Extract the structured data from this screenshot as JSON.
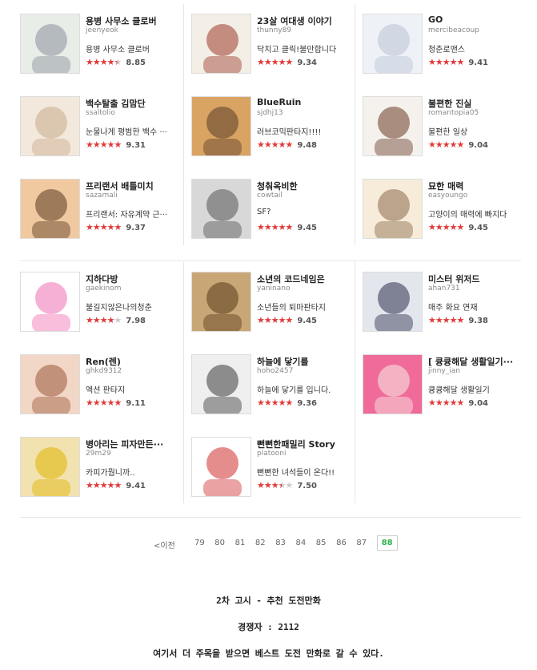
{
  "sections": [
    {
      "rows": [
        [
          {
            "title": "용병 사무소 클로버",
            "author": "jeenyeok",
            "desc": "용병 사무소 클로버",
            "score": "8.85",
            "stars": 4.5,
            "thumb": {
              "bg": "#e8ede8",
              "fg": "#8a8f9a"
            }
          },
          {
            "title": "23살 여대생 이야기",
            "author": "thunny89",
            "desc": "닥치고 클릭!불만합니다",
            "score": "9.34",
            "stars": 5,
            "thumb": {
              "bg": "#f4efe6",
              "fg": "#9a3b2a"
            }
          },
          {
            "title": "GO",
            "author": "mercibeacoup",
            "desc": "청춘로맨스",
            "score": "9.41",
            "stars": 5,
            "thumb": {
              "bg": "#eef1f6",
              "fg": "#b9c3d6"
            }
          }
        ],
        [
          {
            "title": "백수탈출 김맘단",
            "author": "ssaltolio",
            "desc": "눈물나게 평범한 백수 ···",
            "score": "9.31",
            "stars": 5,
            "thumb": {
              "bg": "#f2e9dc",
              "fg": "#c9a98a"
            }
          },
          {
            "title": "BlueRuin",
            "author": "sjdhj13",
            "desc": "러브코믹판타지!!!!",
            "score": "9.48",
            "stars": 5,
            "thumb": {
              "bg": "#d9a463",
              "fg": "#5a3c2a"
            }
          },
          {
            "title": "불편한 진실",
            "author": "romantopia05",
            "desc": "불편한 일상",
            "score": "9.04",
            "stars": 5,
            "thumb": {
              "bg": "#f5f2ee",
              "fg": "#6a3a25"
            }
          }
        ],
        [
          {
            "title": "프리랜서 배틀미치",
            "author": "sazamali",
            "desc": "프리랜서: 자유계약 근···",
            "score": "9.37",
            "stars": 5,
            "thumb": {
              "bg": "#f0c9a0",
              "fg": "#5a3a20"
            }
          },
          {
            "title": "청춰옥비한",
            "author": "cowtail",
            "desc": "SF?",
            "score": "9.45",
            "stars": 5,
            "thumb": {
              "bg": "#d8d8d8",
              "fg": "#555555"
            }
          },
          {
            "title": "묘한 매력",
            "author": "easyoungo",
            "desc": "고양이의 매력에 빠지다",
            "score": "9.45",
            "stars": 5,
            "thumb": {
              "bg": "#f6ecd9",
              "fg": "#8a6a4a"
            }
          }
        ]
      ]
    },
    {
      "rows": [
        [
          {
            "title": "지하다방",
            "author": "gaekinom",
            "desc": "불길지않은나의청춘",
            "score": "7.98",
            "stars": 4,
            "thumb": {
              "bg": "#ffffff",
              "fg": "#f06fb2"
            }
          },
          {
            "title": "소년의 코드네임은",
            "author": "yaninano",
            "desc": "소년들의 퇴마판타지",
            "score": "9.45",
            "stars": 5,
            "thumb": {
              "bg": "#c8a676",
              "fg": "#5a3a1c"
            }
          },
          {
            "title": "미스터 위저드",
            "author": "ahan731",
            "desc": "매주 화요 연재",
            "score": "9.38",
            "stars": 5,
            "thumb": {
              "bg": "#e4e6ee",
              "fg": "#2a2f4a"
            }
          }
        ],
        [
          {
            "title": "Ren(렌)",
            "author": "ghkd9312",
            "desc": "액션 판타지",
            "score": "9.11",
            "stars": 5,
            "thumb": {
              "bg": "#f2d6c6",
              "fg": "#9a5a3a"
            }
          },
          {
            "title": "하늘에 닿기를",
            "author": "hoho2457",
            "desc": "하늘에 닿기를 입니다.",
            "score": "9.36",
            "stars": 5,
            "thumb": {
              "bg": "#efefef",
              "fg": "#3a3a3a"
            }
          },
          {
            "title": "[ 큥큥해달 생활일기···",
            "author": "jinny_ian",
            "desc": "큥큥해달 생활일기",
            "score": "9.04",
            "stars": 5,
            "thumb": {
              "bg": "#f06a9a",
              "fg": "#f6efe6"
            }
          }
        ],
        [
          {
            "title": "병아리는 피자만든···",
            "author": "29m29",
            "desc": "카피가뭡니까..",
            "score": "9.41",
            "stars": 5,
            "thumb": {
              "bg": "#f2e2b0",
              "fg": "#e0b400"
            }
          },
          {
            "title": "뻔뻔한패밀리 Story",
            "author": "platooni",
            "desc": "뻔뻔한 녀석들이 온다!!",
            "score": "7.50",
            "stars": 3.5,
            "thumb": {
              "bg": "#ffffff",
              "fg": "#d03030"
            }
          }
        ]
      ]
    }
  ],
  "pagination": {
    "prev_label": "<이전",
    "pages": [
      "79",
      "80",
      "81",
      "82",
      "83",
      "84",
      "85",
      "86",
      "87",
      "88"
    ],
    "current": "88"
  },
  "footer": {
    "line1": "2차 고시 - 추천 도전만화",
    "line2": "경쟁자 : 2112",
    "line3": "여기서 더 주목을 받으면 베스트 도전 만화로 갈 수 있다."
  },
  "colors": {
    "star": "#e03a3a",
    "star_off": "#cccccc",
    "current_page": "#2bb24c"
  }
}
